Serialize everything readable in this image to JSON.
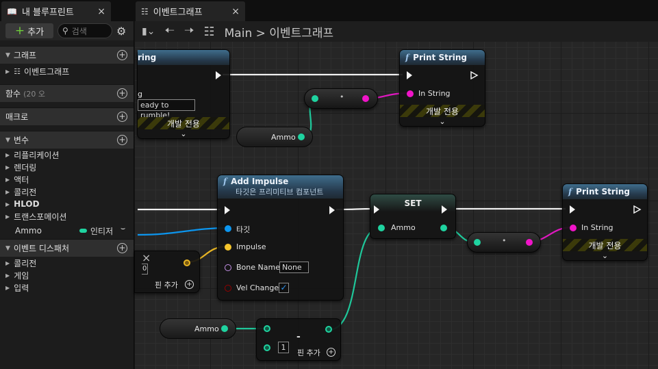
{
  "tabs": [
    {
      "label": "내 블루프린트",
      "close": "×"
    },
    {
      "label": "이벤트그래프",
      "close": "×"
    }
  ],
  "left_panel": {
    "add_label": "추가",
    "add_plus": "+",
    "search_placeholder": "검색",
    "sections": {
      "graph": "그래프",
      "functions": "함수",
      "functions_count": "(20 오",
      "macros": "매크로",
      "variables": "변수",
      "dispatchers": "이벤트 디스패처"
    },
    "graph_item": "이벤트그래프",
    "variable_categories": [
      "리플리케이션",
      "렌더링",
      "액터",
      "콜리전",
      "HLOD",
      "트랜스포메이션"
    ],
    "variable": {
      "name": "Ammo",
      "type": "인티저",
      "type_color": "#1fd3a0"
    },
    "dispatcher_categories": [
      "콜리전",
      "게임",
      "입력"
    ]
  },
  "graph_toolbar": {
    "breadcrumb_root": "Main",
    "breadcrumb_sep": ">",
    "breadcrumb_current": "이벤트그래프"
  },
  "nodes": {
    "print1": {
      "title": "Print String",
      "in_string": "In String",
      "dev_only": "개발 전용"
    },
    "print2": {
      "title": "Print String",
      "in_string": "In String",
      "dev_only": "개발 전용"
    },
    "left_partial": {
      "title": "ring",
      "pin": "g",
      "text_value": "eady to rumble!",
      "dev_only": "개발 전용"
    },
    "impulse": {
      "title": "Add Impulse",
      "subtitle": "타깃은 프리미티브 컴포넌트",
      "target": "타깃",
      "impulse": "Impulse",
      "bone_name": "Bone Name",
      "bone_value": "None",
      "vel_change": "Vel Change"
    },
    "set": {
      "title": "SET",
      "pin": "Ammo"
    },
    "ammo_get1": {
      "label": "Ammo"
    },
    "ammo_get2": {
      "label": "Ammo"
    },
    "make_small": {
      "value": "0",
      "add_pin": "핀 추가",
      "x": "×"
    },
    "subtract": {
      "op": "-",
      "value": "1",
      "add_pin": "핀 추가"
    }
  },
  "colors": {
    "exec": "#f2f2f2",
    "integer": "#1fd3a0",
    "string": "#f014c8",
    "object": "#0c96ef",
    "vector": "#f5c52c",
    "name": "#c792ea",
    "bool": "#950000"
  },
  "icons": [
    "blueprint-book-icon",
    "event-graph-icon",
    "close-icon",
    "search-icon",
    "gear-icon",
    "plus-circle-icon",
    "back-arrow-icon",
    "forward-arrow-icon",
    "bookmark-icon",
    "chevron-down-icon",
    "function-icon",
    "checkbox-icon"
  ]
}
